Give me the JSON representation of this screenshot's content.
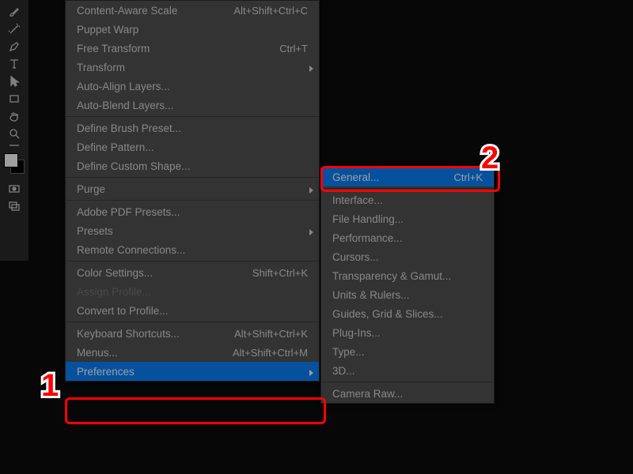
{
  "toolbox": {
    "tools": [
      {
        "name": "brush-icon"
      },
      {
        "name": "wand-icon"
      },
      {
        "name": "pen-icon"
      },
      {
        "name": "type-icon"
      },
      {
        "name": "path-select-icon"
      },
      {
        "name": "rectangle-icon"
      },
      {
        "name": "hand-icon"
      },
      {
        "name": "zoom-icon"
      }
    ]
  },
  "annotations": {
    "one": "1",
    "two": "2"
  },
  "edit_menu": {
    "groups": [
      [
        {
          "label": "Content-Aware Scale",
          "shortcut": "Alt+Shift+Ctrl+C",
          "submenu": false,
          "disabled": false
        },
        {
          "label": "Puppet Warp",
          "shortcut": "",
          "submenu": false,
          "disabled": false
        },
        {
          "label": "Free Transform",
          "shortcut": "Ctrl+T",
          "submenu": false,
          "disabled": false
        },
        {
          "label": "Transform",
          "shortcut": "",
          "submenu": true,
          "disabled": false
        },
        {
          "label": "Auto-Align Layers...",
          "shortcut": "",
          "submenu": false,
          "disabled": false
        },
        {
          "label": "Auto-Blend Layers...",
          "shortcut": "",
          "submenu": false,
          "disabled": false
        }
      ],
      [
        {
          "label": "Define Brush Preset...",
          "shortcut": "",
          "submenu": false,
          "disabled": false
        },
        {
          "label": "Define Pattern...",
          "shortcut": "",
          "submenu": false,
          "disabled": false
        },
        {
          "label": "Define Custom Shape...",
          "shortcut": "",
          "submenu": false,
          "disabled": false
        }
      ],
      [
        {
          "label": "Purge",
          "shortcut": "",
          "submenu": true,
          "disabled": false
        }
      ],
      [
        {
          "label": "Adobe PDF Presets...",
          "shortcut": "",
          "submenu": false,
          "disabled": false
        },
        {
          "label": "Presets",
          "shortcut": "",
          "submenu": true,
          "disabled": false
        },
        {
          "label": "Remote Connections...",
          "shortcut": "",
          "submenu": false,
          "disabled": false
        }
      ],
      [
        {
          "label": "Color Settings...",
          "shortcut": "Shift+Ctrl+K",
          "submenu": false,
          "disabled": false
        },
        {
          "label": "Assign Profile...",
          "shortcut": "",
          "submenu": false,
          "disabled": true
        },
        {
          "label": "Convert to Profile...",
          "shortcut": "",
          "submenu": false,
          "disabled": false
        }
      ],
      [
        {
          "label": "Keyboard Shortcuts...",
          "shortcut": "Alt+Shift+Ctrl+K",
          "submenu": false,
          "disabled": false
        },
        {
          "label": "Menus...",
          "shortcut": "Alt+Shift+Ctrl+M",
          "submenu": false,
          "disabled": false
        },
        {
          "label": "Preferences",
          "shortcut": "",
          "submenu": true,
          "disabled": false,
          "highlight": true
        }
      ]
    ]
  },
  "pref_submenu": {
    "groups": [
      [
        {
          "label": "General...",
          "shortcut": "Ctrl+K",
          "highlight": true
        }
      ],
      [
        {
          "label": "Interface..."
        },
        {
          "label": "File Handling..."
        },
        {
          "label": "Performance..."
        },
        {
          "label": "Cursors..."
        },
        {
          "label": "Transparency & Gamut..."
        },
        {
          "label": "Units & Rulers..."
        },
        {
          "label": "Guides, Grid & Slices..."
        },
        {
          "label": "Plug-Ins..."
        },
        {
          "label": "Type..."
        },
        {
          "label": "3D..."
        }
      ],
      [
        {
          "label": "Camera Raw..."
        }
      ]
    ]
  }
}
